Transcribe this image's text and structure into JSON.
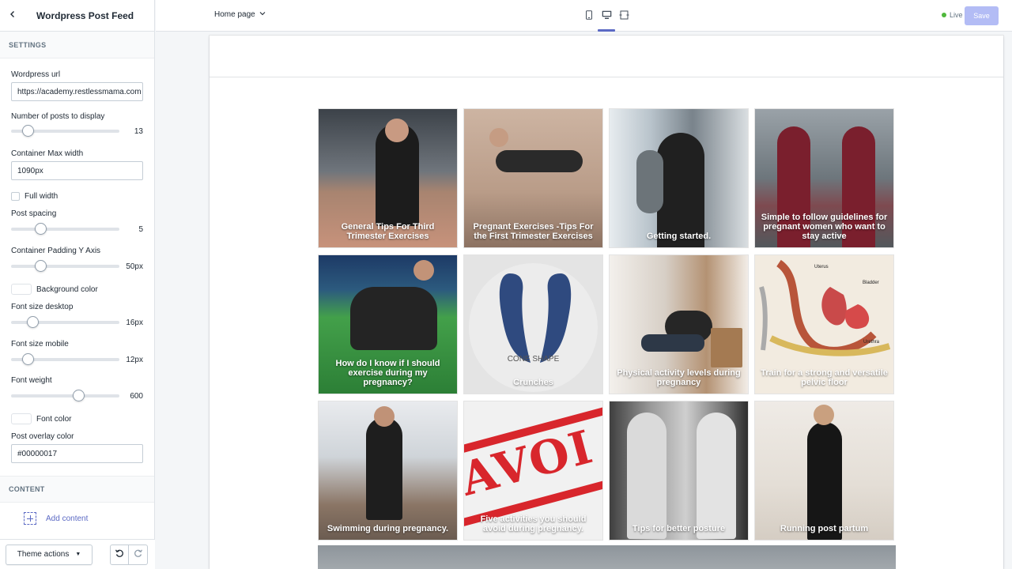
{
  "sidebar": {
    "title": "Wordpress Post Feed",
    "settings_heading": "SETTINGS",
    "wordpress_url": {
      "label": "Wordpress url",
      "value": "https://academy.restlessmama.com"
    },
    "posts_to_display": {
      "label": "Number of posts to display",
      "value": "13",
      "fraction": 0.15
    },
    "container_max_width": {
      "label": "Container Max width",
      "value": "1090px"
    },
    "full_width": {
      "label": "Full width",
      "checked": false
    },
    "post_spacing": {
      "label": "Post spacing",
      "value": "5",
      "fraction": 0.27
    },
    "container_padding_y": {
      "label": "Container Padding Y Axis",
      "value": "50px",
      "fraction": 0.27
    },
    "background_color": {
      "label": "Background color",
      "color": "#ffffff"
    },
    "font_size_desktop": {
      "label": "Font size desktop",
      "value": "16px",
      "fraction": 0.2
    },
    "font_size_mobile": {
      "label": "Font size mobile",
      "value": "12px",
      "fraction": 0.15
    },
    "font_weight": {
      "label": "Font weight",
      "value": "600",
      "fraction": 0.62
    },
    "font_color": {
      "label": "Font color",
      "color": "#ffffff"
    },
    "post_overlay_color": {
      "label": "Post overlay color",
      "value": "#00000017"
    },
    "content_heading": "CONTENT",
    "add_content_label": "Add content",
    "theme_actions_label": "Theme actions"
  },
  "topbar": {
    "page_select": "Home page",
    "devices": [
      "mobile-icon",
      "desktop-icon",
      "full-width-icon"
    ],
    "active_device": "desktop-icon",
    "status": "Live",
    "save_label": "Save"
  },
  "posts": [
    {
      "title": "General Tips For Third Trimester Exercises",
      "image": "gym"
    },
    {
      "title": "Pregnant Exercises -Tips For the First Trimester Exercises",
      "image": "beige"
    },
    {
      "title": "Getting started.",
      "image": "window"
    },
    {
      "title": "Simple to follow guidelines for pregnant women who want to stay active",
      "image": "red"
    },
    {
      "title": "How do I know if I should exercise during my pregnancy?",
      "image": "field"
    },
    {
      "title": "Crunches",
      "image": "light",
      "caption": "CONE SHAPE"
    },
    {
      "title": "Physical activity levels during pregnancy",
      "image": "studio"
    },
    {
      "title": "Train for a strong and versatile pelvic floor",
      "image": "anatomy",
      "labels": [
        "Uterus",
        "Bladder",
        "Urethra"
      ]
    },
    {
      "title": "Swimming during pregnancy.",
      "image": "box"
    },
    {
      "title": "Five activities you should avoid during pregnancy.",
      "image": "avoid",
      "caption": "AVOI"
    },
    {
      "title": "Tips for better posture",
      "image": "bw"
    },
    {
      "title": "Running post partum",
      "image": "studio2"
    }
  ],
  "colors": {
    "accent": "#5c6ac4",
    "live": "#50b83c",
    "save_disabled": "#b3bcf5"
  }
}
